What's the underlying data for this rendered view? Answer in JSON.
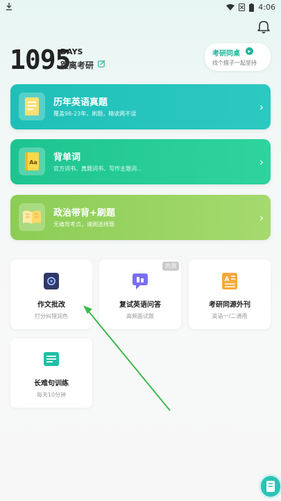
{
  "status": {
    "time": "4:06"
  },
  "countdown": {
    "days": "1095",
    "days_label": "DAYS",
    "subtitle": "距离考研"
  },
  "desk": {
    "title": "考研同桌",
    "subtitle": "找个搭子一起坚持"
  },
  "features": [
    {
      "title": "历年英语真题",
      "subtitle": "覆盖98-23年，刷题，精读两不误"
    },
    {
      "title": "背单词",
      "subtitle": "官方词书、真题词书、写作主题词..."
    },
    {
      "title": "政治带背+刷题",
      "subtitle": "无痛背考点，速刷选择题"
    }
  ],
  "tools": [
    {
      "title": "作文批改",
      "subtitle": "打分纠错润色"
    },
    {
      "title": "复试英语问答",
      "subtitle": "高频面试题",
      "badge": "内测"
    },
    {
      "title": "考研同源外刊",
      "subtitle": "英语一/二通用"
    },
    {
      "title": "长难句训练",
      "subtitle": "每天10分钟"
    }
  ],
  "colors": {
    "accent": "#1fb39a",
    "card1": "#27c4bc",
    "card2": "#26cb95",
    "card3": "#98d360",
    "arrow": "#3cb94a"
  }
}
